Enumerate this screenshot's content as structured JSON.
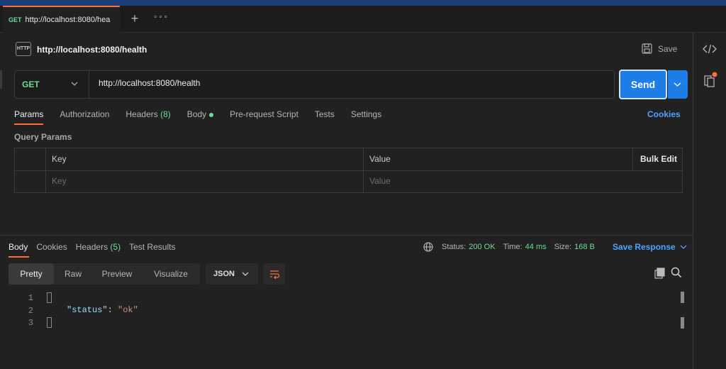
{
  "tab": {
    "method": "GET",
    "title": "http://localhost:8080/hea"
  },
  "request": {
    "title": "http://localhost:8080/health",
    "save_label": "Save",
    "method": "GET",
    "url": "http://localhost:8080/health",
    "send_label": "Send"
  },
  "req_tabs": {
    "params": "Params",
    "authorization": "Authorization",
    "headers": "Headers",
    "headers_count": "(8)",
    "body": "Body",
    "prerequest": "Pre-request Script",
    "tests": "Tests",
    "settings": "Settings",
    "cookies": "Cookies"
  },
  "query_params": {
    "label": "Query Params",
    "col_key": "Key",
    "col_value": "Value",
    "bulk_edit": "Bulk Edit",
    "key_placeholder": "Key",
    "value_placeholder": "Value"
  },
  "response": {
    "tabs": {
      "body": "Body",
      "cookies": "Cookies",
      "headers": "Headers",
      "headers_count": "(5)",
      "test_results": "Test Results"
    },
    "status_label": "Status:",
    "status_value": "200 OK",
    "time_label": "Time:",
    "time_value": "44 ms",
    "size_label": "Size:",
    "size_value": "168 B",
    "save_response": "Save Response",
    "views": {
      "pretty": "Pretty",
      "raw": "Raw",
      "preview": "Preview",
      "visualize": "Visualize"
    },
    "format": "JSON",
    "lines": [
      "1",
      "2",
      "3"
    ],
    "json_key": "\"status\"",
    "json_colon": ":",
    "json_value": "\"ok\""
  },
  "icons": [
    "http-icon",
    "save-icon",
    "code-icon",
    "info-panel-icon",
    "chevron-down-icon",
    "globe-icon",
    "wrap-icon",
    "copy-icon",
    "search-icon",
    "plus-icon",
    "more-icon"
  ],
  "colors": {
    "accent": "#ff6c37",
    "send": "#1e7ee8",
    "green": "#6bdd9a",
    "link": "#4da3ff",
    "json_key": "#9cdcfe",
    "json_string": "#ce9178"
  }
}
